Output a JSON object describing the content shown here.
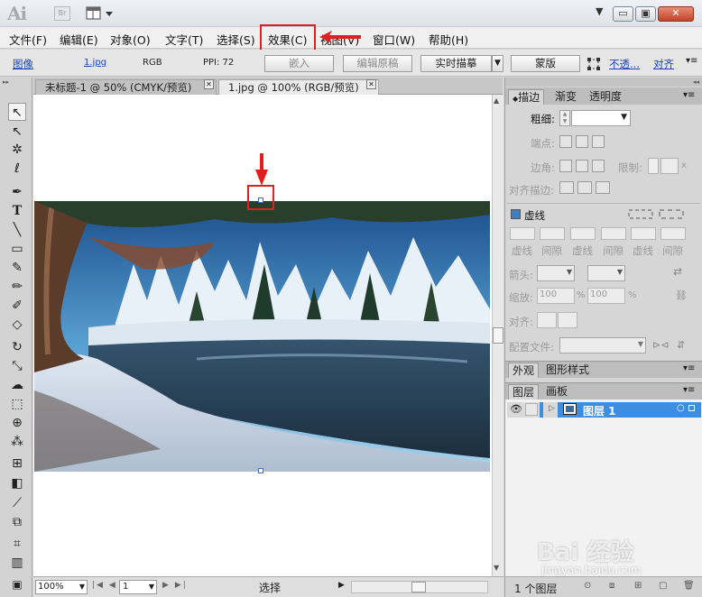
{
  "app": {
    "logo": "Ai",
    "bridge_label": "Br"
  },
  "window_controls": {
    "minimize": "▭",
    "restore": "▣",
    "close": "✕"
  },
  "menu": {
    "items": [
      "文件(F)",
      "编辑(E)",
      "对象(O)",
      "文字(T)",
      "选择(S)",
      "效果(C)",
      "视图(V)",
      "窗口(W)",
      "帮助(H)"
    ]
  },
  "control_bar": {
    "object_type": "图像",
    "filename": "1.jpg",
    "color_mode": "RGB",
    "ppi": "PPI: 72",
    "embed_label": "嵌入",
    "edit_original_label": "编辑原稿",
    "live_trace_label": "实时描摹",
    "mask_label": "蒙版",
    "opacity_label": "不透...",
    "align_label": "对齐"
  },
  "tabs": [
    {
      "label": "未标题-1 @ 50% (CMYK/预览)"
    },
    {
      "label": "1.jpg @ 100% (RGB/预览)"
    }
  ],
  "status_bar": {
    "zoom": "100%",
    "page": "1",
    "tool": "选择"
  },
  "stroke_panel": {
    "tabs": [
      "描边",
      "渐变",
      "透明度"
    ],
    "weight_label": "粗细:",
    "cap_label": "端点:",
    "corner_label": "边角:",
    "limit_label": "限制:",
    "limit_unit": "x",
    "align_label": "对齐描边:",
    "dashed_label": "虚线",
    "dash_labels": [
      "虚线",
      "间隙",
      "虚线",
      "间隙",
      "虚线",
      "间隙"
    ],
    "arrowheads_label": "箭头:",
    "scale_label": "缩放:",
    "scale_start": "100",
    "scale_end": "100",
    "scale_unit": "%",
    "align_arrow_label": "对齐:",
    "profile_label": "配置文件:"
  },
  "appearance_panel": {
    "tabs": [
      "外观",
      "图形样式"
    ]
  },
  "layers_panel": {
    "tabs": [
      "图层",
      "画板"
    ],
    "layer_name": "图层 1",
    "footer_count": "1 个图层"
  },
  "watermark": {
    "brand": "Bai 经验",
    "url": "jingyan.baidu.com"
  },
  "colors": {
    "annotation_red": "#e02020",
    "layer_selected": "#3d8ee0",
    "link_blue": "#1a3fc0"
  }
}
